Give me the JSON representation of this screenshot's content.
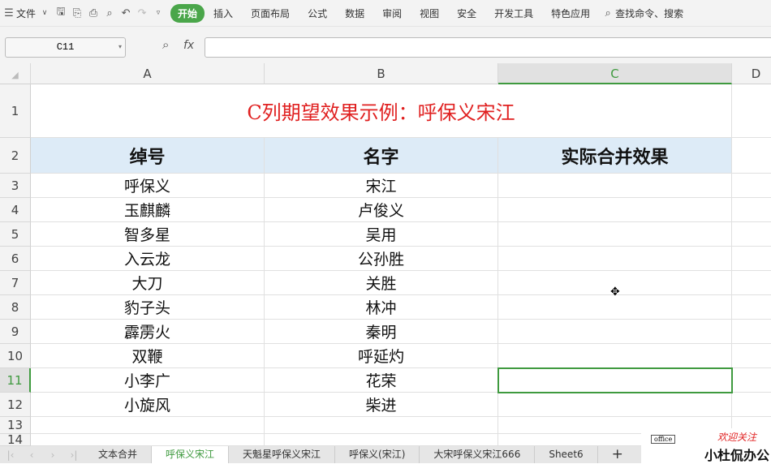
{
  "menubar": {
    "file": "文件",
    "start": "开始",
    "items": [
      "插入",
      "页面布局",
      "公式",
      "数据",
      "审阅",
      "视图",
      "安全",
      "开发工具",
      "特色应用"
    ],
    "search": "查找命令、搜索"
  },
  "formula_bar": {
    "name_box": "C11",
    "fx": "fx",
    "value": ""
  },
  "columns": [
    "A",
    "B",
    "C",
    "D"
  ],
  "selected_column": "C",
  "rows": [
    "1",
    "2",
    "3",
    "4",
    "5",
    "6",
    "7",
    "8",
    "9",
    "10",
    "11",
    "12",
    "13",
    "14"
  ],
  "selected_row": "11",
  "title": "C列期望效果示例：呼保义宋江",
  "headers": [
    "绰号",
    "名字",
    "实际合并效果"
  ],
  "data": [
    [
      "呼保义",
      "宋江"
    ],
    [
      "玉麒麟",
      "卢俊义"
    ],
    [
      "智多星",
      "吴用"
    ],
    [
      "入云龙",
      "公孙胜"
    ],
    [
      "大刀",
      "关胜"
    ],
    [
      "豹子头",
      "林冲"
    ],
    [
      "霹雳火",
      "秦明"
    ],
    [
      "双鞭",
      "呼延灼"
    ],
    [
      "小李广",
      "花荣"
    ],
    [
      "小旋风",
      "柴进"
    ]
  ],
  "sheets": [
    "文本合并",
    "呼保义宋江",
    "天魁星呼保义宋江",
    "呼保义(宋江)",
    "大宋呼保义宋江666",
    "Sheet6"
  ],
  "active_sheet": "呼保义宋江",
  "watermark": {
    "line1": "欢迎关注",
    "line2": "小杜侃办公",
    "badge": "office"
  },
  "colors": {
    "accent": "#3f9a3f",
    "title": "#e02020",
    "header_fill": "#ddebf7"
  }
}
